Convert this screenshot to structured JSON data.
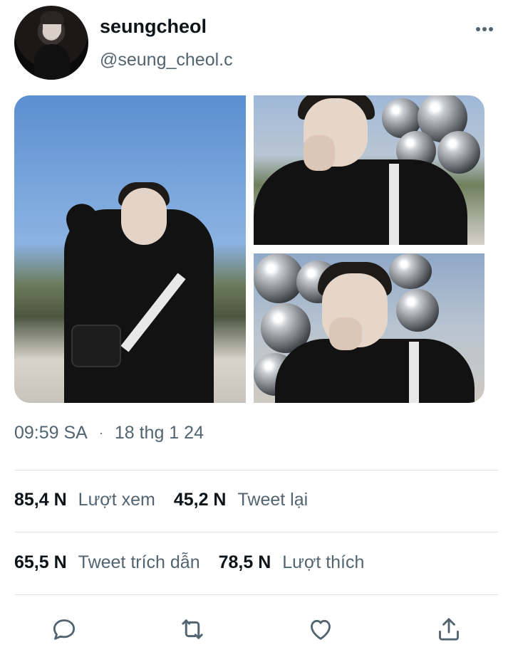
{
  "author": {
    "display_name": "seungcheol",
    "handle": "@seung_cheol.c",
    "avatar_icon": "profile-photo"
  },
  "more_icon": "more-horizontal-icon",
  "media": [
    {
      "name": "photo-1",
      "icon": "photo"
    },
    {
      "name": "photo-2",
      "icon": "photo"
    },
    {
      "name": "photo-3",
      "icon": "photo"
    }
  ],
  "timestamp": {
    "time": "09:59 SA",
    "separator": "·",
    "date": "18 thg 1 24"
  },
  "stats": {
    "views": {
      "value": "85,4 N",
      "label": "Lượt xem"
    },
    "retweets": {
      "value": "45,2 N",
      "label": "Tweet lại"
    },
    "quotes": {
      "value": "65,5 N",
      "label": "Tweet trích dẫn"
    },
    "likes": {
      "value": "78,5 N",
      "label": "Lượt thích"
    }
  },
  "actions": [
    {
      "name": "reply",
      "icon": "reply-icon"
    },
    {
      "name": "retweet",
      "icon": "retweet-icon"
    },
    {
      "name": "like",
      "icon": "heart-icon"
    },
    {
      "name": "share",
      "icon": "share-icon"
    }
  ],
  "colors": {
    "text_primary": "#0f1419",
    "text_secondary": "#536471",
    "divider": "#e1e6ea",
    "icon": "#536471"
  }
}
